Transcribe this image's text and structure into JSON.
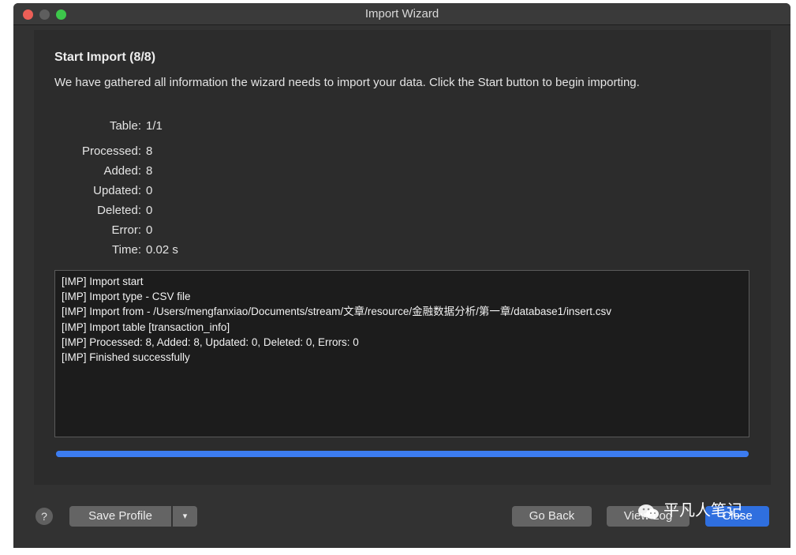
{
  "window": {
    "title": "Import Wizard"
  },
  "step": {
    "heading": "Start Import (8/8)",
    "description": "We have gathered all information the wizard needs to import your data. Click the Start button to begin importing."
  },
  "stats": {
    "table_label": "Table:",
    "table_value": "1/1",
    "processed_label": "Processed:",
    "processed_value": "8",
    "added_label": "Added:",
    "added_value": "8",
    "updated_label": "Updated:",
    "updated_value": "0",
    "deleted_label": "Deleted:",
    "deleted_value": "0",
    "error_label": "Error:",
    "error_value": "0",
    "time_label": "Time:",
    "time_value": "0.02 s"
  },
  "log": {
    "lines": [
      "[IMP] Import start",
      "[IMP] Import type - CSV file",
      "[IMP] Import from - /Users/mengfanxiao/Documents/stream/文章/resource/金融数据分析/第一章/database1/insert.csv",
      "[IMP] Import table [transaction_info]",
      "[IMP] Processed: 8, Added: 8, Updated: 0, Deleted: 0, Errors: 0",
      "[IMP] Finished successfully"
    ]
  },
  "progress": {
    "value": 1.0,
    "color": "#3c7cf0"
  },
  "buttons": {
    "help": "?",
    "save_profile": "Save Profile",
    "save_profile_arrow": "▾",
    "go_back": "Go Back",
    "view_log": "View Log",
    "close": "Close"
  },
  "watermark": {
    "text": "平凡人笔记"
  },
  "colors": {
    "window_bg": "#323232",
    "accent": "#2f6fdf",
    "button_bg": "#646464"
  }
}
